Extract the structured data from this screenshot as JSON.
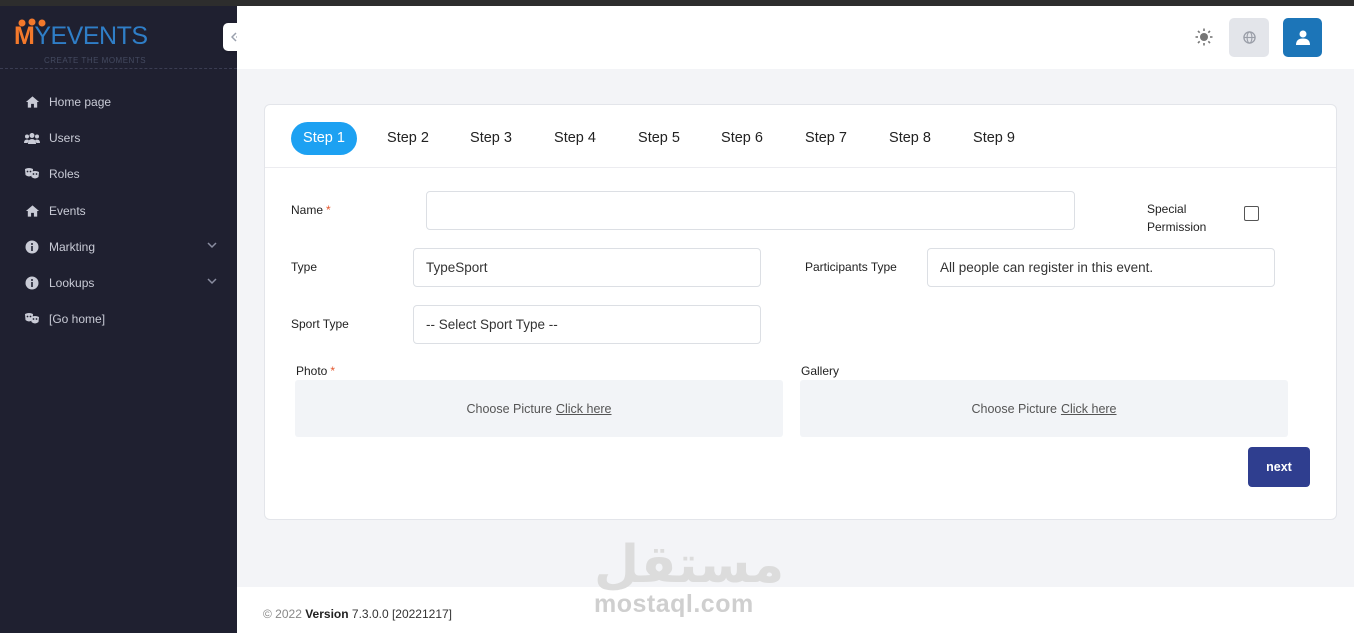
{
  "app": {
    "logo_m": "M",
    "logo_rest": "YEVENTS",
    "logo_tagline": "CREATE THE MOMENTS"
  },
  "sidebar": {
    "items": [
      {
        "label": "Home page",
        "icon": "home-icon"
      },
      {
        "label": "Users",
        "icon": "users-icon"
      },
      {
        "label": "Roles",
        "icon": "masks-icon"
      },
      {
        "label": "Events",
        "icon": "home-icon"
      },
      {
        "label": "Markting",
        "icon": "info-icon",
        "expandable": true
      },
      {
        "label": "Lookups",
        "icon": "info-icon",
        "expandable": true
      },
      {
        "label": "[Go home]",
        "icon": "masks-icon"
      }
    ]
  },
  "steps": [
    "Step 1",
    "Step 2",
    "Step 3",
    "Step 4",
    "Step 5",
    "Step 6",
    "Step 7",
    "Step 8",
    "Step 9"
  ],
  "active_step": 0,
  "form": {
    "name_label": "Name",
    "name_value": "",
    "special_permission_label_1": "Special",
    "special_permission_label_2": "Permission",
    "type_label": "Type",
    "type_value": "TypeSport",
    "participants_label": "Participants Type",
    "participants_value": "All people can register in this event.",
    "sport_type_label": "Sport Type",
    "sport_type_value": "-- Select Sport Type --",
    "photo_label": "Photo",
    "gallery_label": "Gallery",
    "choose_picture": "Choose Picture",
    "click_here": "Click here",
    "required_mark": "*",
    "next_label": "next"
  },
  "footer": {
    "copyright": "© 2022",
    "version_label": "Version",
    "version_value": "7.3.0.0 [20221217]"
  },
  "watermark": {
    "arabic": "مستقل",
    "latin": "mostaql.com"
  },
  "colors": {
    "sidebar_bg": "#1f2030",
    "active_step": "#1da1f2",
    "next_button": "#2f3e8f",
    "user_button": "#1c75b8",
    "logo_orange": "#f4792b",
    "logo_blue": "#2f7ec7"
  }
}
